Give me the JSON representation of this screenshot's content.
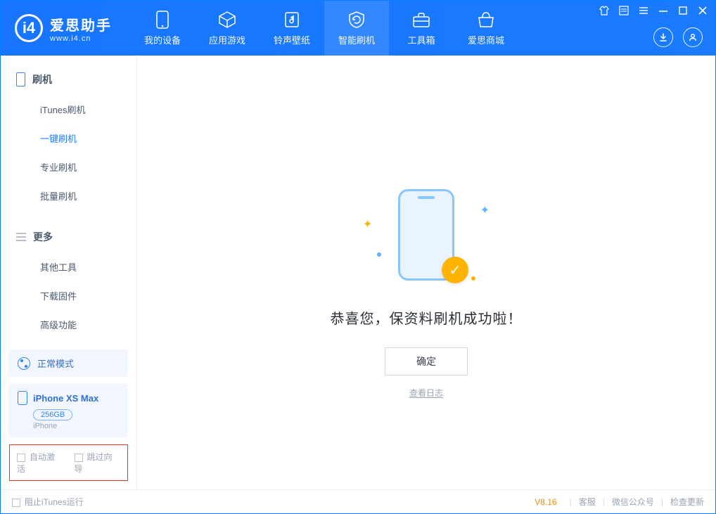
{
  "app": {
    "name": "爱思助手",
    "url": "www.i4.cn"
  },
  "tabs": [
    {
      "label": "我的设备"
    },
    {
      "label": "应用游戏"
    },
    {
      "label": "铃声壁纸"
    },
    {
      "label": "智能刷机"
    },
    {
      "label": "工具箱"
    },
    {
      "label": "爱思商城"
    }
  ],
  "sidebar": {
    "group1": {
      "title": "刷机",
      "items": [
        "iTunes刷机",
        "一键刷机",
        "专业刷机",
        "批量刷机"
      ]
    },
    "group2": {
      "title": "更多",
      "items": [
        "其他工具",
        "下载固件",
        "高级功能"
      ]
    }
  },
  "mode": {
    "label": "正常模式"
  },
  "device": {
    "name": "iPhone XS Max",
    "capacity": "256GB",
    "sub": "iPhone"
  },
  "options": {
    "auto_activate": "自动激活",
    "skip_guide": "跳过向导"
  },
  "main": {
    "success": "恭喜您，保资料刷机成功啦！",
    "ok": "确定",
    "view_log": "查看日志"
  },
  "status": {
    "block_itunes": "阻止iTunes运行",
    "version": "V8.16",
    "links": [
      "客服",
      "微信公众号",
      "检查更新"
    ]
  }
}
